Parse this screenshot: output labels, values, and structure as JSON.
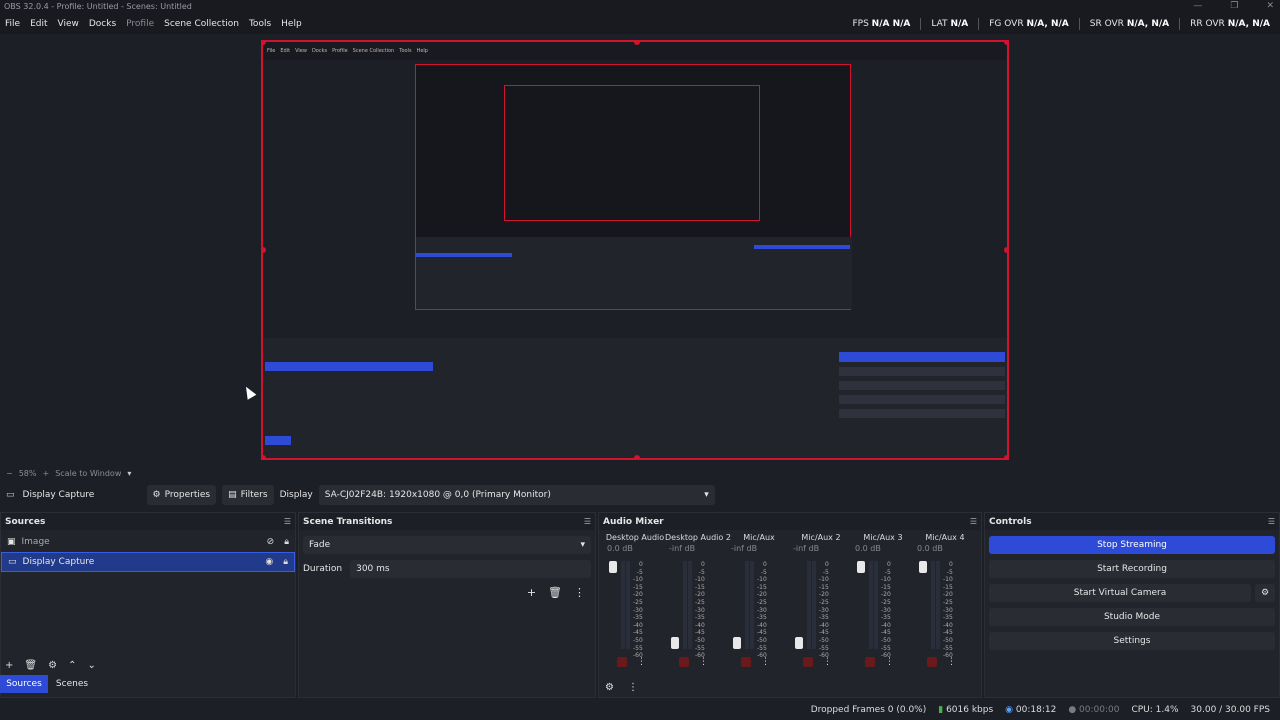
{
  "window": {
    "title": "OBS 32.0.4 - Profile: Untitled - Scenes: Untitled",
    "controls": [
      "—",
      "❐",
      "✕"
    ]
  },
  "menu": [
    "File",
    "Edit",
    "View",
    "Docks",
    "Profile",
    "Scene Collection",
    "Tools",
    "Help"
  ],
  "stats": [
    {
      "label": "FPS",
      "value": "N/A  N/A"
    },
    {
      "label": "LAT",
      "value": "N/A"
    },
    {
      "label": "FG OVR",
      "value": "N/A, N/A"
    },
    {
      "label": "SR OVR",
      "value": "N/A, N/A"
    },
    {
      "label": "RR OVR",
      "value": "N/A, N/A"
    }
  ],
  "zoom": {
    "minus": "−",
    "value": "58%",
    "plus": "+",
    "mode": "Scale to Window"
  },
  "source_toolbar": {
    "source_name": "Display Capture",
    "properties": "Properties",
    "filters": "Filters",
    "display_label": "Display",
    "display_value": "SA-CJ02F24B: 1920x1080 @ 0,0 (Primary Monitor)"
  },
  "sources": {
    "title": "Sources",
    "items": [
      {
        "name": "Image",
        "selected": false,
        "visible": false
      },
      {
        "name": "Display Capture",
        "selected": true,
        "visible": true
      }
    ]
  },
  "dock_tabs": [
    "Sources",
    "Scenes"
  ],
  "transitions": {
    "title": "Scene Transitions",
    "transition": "Fade",
    "duration_label": "Duration",
    "duration_value": "300 ms"
  },
  "mixer": {
    "title": "Audio Mixer",
    "channels": [
      {
        "name": "Desktop Audio",
        "db": "0.0 dB",
        "level": 0.0,
        "fader": 1.0
      },
      {
        "name": "Desktop Audio 2",
        "db": "-inf dB",
        "level": 0.0,
        "fader": 0.0
      },
      {
        "name": "Mic/Aux",
        "db": "-inf dB",
        "level": 0.0,
        "fader": 0.0
      },
      {
        "name": "Mic/Aux 2",
        "db": "-inf dB",
        "level": 0.0,
        "fader": 0.0
      },
      {
        "name": "Mic/Aux 3",
        "db": "0.0 dB",
        "level": 0.0,
        "fader": 1.0
      },
      {
        "name": "Mic/Aux 4",
        "db": "0.0 dB",
        "level": 0.0,
        "fader": 1.0
      }
    ],
    "scale": [
      "0",
      "-5",
      "-10",
      "-15",
      "-20",
      "-25",
      "-30",
      "-35",
      "-40",
      "-45",
      "-50",
      "-55",
      "-60"
    ]
  },
  "controls": {
    "title": "Controls",
    "buttons": [
      "Stop Streaming",
      "Start Recording",
      "Start Virtual Camera",
      "Studio Mode",
      "Settings"
    ]
  },
  "status": {
    "dropped": "Dropped Frames 0 (0.0%)",
    "bitrate": "6016 kbps",
    "stream_time": "00:18:12",
    "rec_time": "00:00:00",
    "cpu": "CPU: 1.4%",
    "fps": "30.00 / 30.00 FPS"
  },
  "colors": {
    "accent": "#2d4bd6",
    "preview_border": "#d2122e",
    "background": "#1d1f26"
  }
}
